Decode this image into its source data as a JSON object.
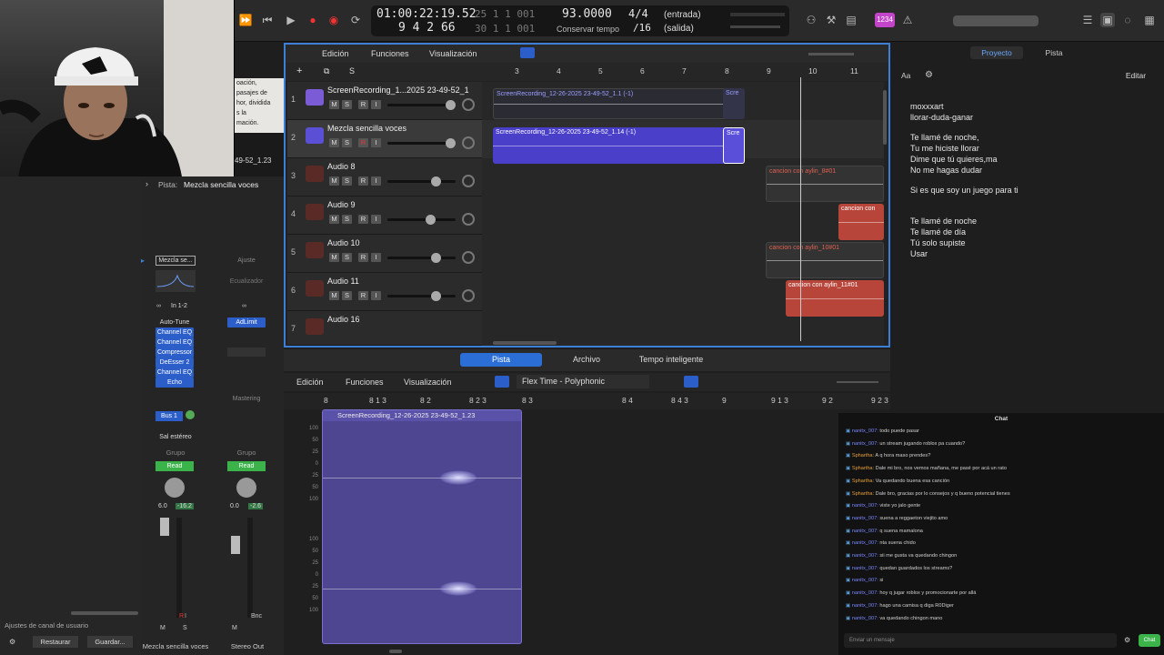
{
  "transport": {
    "time": "01:00:22:19.52",
    "bars_top": "25  1  1   001",
    "bars": "9  4  2   66",
    "bars_bottom": "30  1  1   001",
    "tempo": "93.0000",
    "tempo_label": "Conservar tempo",
    "signature": "4/4",
    "division": "/16",
    "in_label": "(entrada)",
    "out_label": "(salida)",
    "badge": "1234"
  },
  "webcam": {
    "overlay_time": "49-52_1.23",
    "note_lines": [
      "oación,",
      "pasajes de",
      "hor, dividida",
      "s la",
      "mación."
    ]
  },
  "inspector": {
    "track_label": "Pista:",
    "track_name": "Mezcla sencilla voces",
    "strip1_name": "Mezcla se...",
    "strip2_setting": "Ajuste",
    "eq_label": "Ecualizador",
    "input": "In 1-2",
    "plugins": [
      "Auto-Tune",
      "Channel EQ",
      "Channel EQ",
      "Compressor",
      "DeEsser 2",
      "Channel EQ",
      "Echo"
    ],
    "strip2_plugin": "AdLimit",
    "mastering": "Mastering",
    "bus": "Bus 1",
    "output": "Sal estéreo",
    "group": "Grupo",
    "read": "Read",
    "vol1": "6.0",
    "peak1": "-16.2",
    "vol2": "0.0",
    "peak2": "-2.6",
    "bnc": "Bnc",
    "m": "M",
    "s": "S",
    "r": "R",
    "i": "I",
    "strip1_footer": "Mezcla sencilla voces",
    "strip2_footer": "Stereo Out",
    "channel_settings": "Ajustes de canal de usuario",
    "restore": "Restaurar",
    "save": "Guardar..."
  },
  "arrange": {
    "menus": [
      "Edición",
      "Funciones",
      "Visualización"
    ],
    "ruler": [
      "3",
      "4",
      "5",
      "6",
      "7",
      "8",
      "9",
      "10",
      "11"
    ],
    "tracks": [
      {
        "num": "1",
        "name": "ScreenRecording_1...2025 23-49-52_1",
        "color": "#7b5bd6"
      },
      {
        "num": "2",
        "name": "Mezcla sencilla voces",
        "color": "#5b4fd6"
      },
      {
        "num": "3",
        "name": "Audio 8",
        "color": "#b8453a"
      },
      {
        "num": "4",
        "name": "Audio 9",
        "color": "#b8453a"
      },
      {
        "num": "5",
        "name": "Audio 10",
        "color": "#b8453a"
      },
      {
        "num": "6",
        "name": "Audio 11",
        "color": "#b8453a"
      },
      {
        "num": "7",
        "name": "Audio 16",
        "color": "#b8453a"
      }
    ],
    "regions": {
      "r1": "ScreenRecording_12-26-2025 23-49-52_1.1 (-1)",
      "r1b": "Scre",
      "r2": "ScreenRecording_12-26-2025 23-49-52_1.14 (-1)",
      "r2b": "Scre",
      "r3": "cancion con aylin_8#01",
      "r4": "cancion con",
      "r5": "cancion con aylin_10#01",
      "r6": "cancion con aylin_11#01"
    }
  },
  "editor": {
    "tabs": [
      "Pista",
      "Archivo",
      "Tempo inteligente"
    ],
    "menus": [
      "Edición",
      "Funciones",
      "Visualización"
    ],
    "flex": "Flex Time - Polyphonic",
    "ruler": [
      "8",
      "8 1 3",
      "8 2",
      "8 2 3",
      "8 3",
      "8 4",
      "8 4 3",
      "9",
      "9 1 3",
      "9 2",
      "9 2 3"
    ],
    "region_name": "ScreenRecording_12-26-2025 23-49-52_1.23",
    "db_scale": [
      "100",
      "50",
      "25",
      "0",
      "25",
      "50",
      "100",
      "100",
      "50",
      "25",
      "0",
      "25",
      "50",
      "100"
    ]
  },
  "right": {
    "tabs": [
      "Proyecto",
      "Pista"
    ],
    "edit": "Editar",
    "aa": "Aa",
    "lyrics": [
      "moxxxart",
      "llorar-duda-ganar",
      "",
      "Te llamé de noche,",
      "Tu me hiciste llorar",
      "Dime que tú quieres,ma",
      "No me hagas dudar",
      "",
      "Si es que soy un juego para ti",
      "",
      "",
      "Te llamé de noche",
      "Te llamé de día",
      "Tú solo supiste",
      "Usar"
    ]
  },
  "chat": {
    "title": "Chat",
    "messages": [
      {
        "user": "nanitx_007:",
        "text": "todo puede pasar",
        "c": "u1"
      },
      {
        "user": "nanitx_007:",
        "text": "un stream jugando roblox pa cuando?",
        "c": "u1"
      },
      {
        "user": "Sphartha:",
        "text": "A q hora maso prendes?",
        "c": "u2"
      },
      {
        "user": "Sphartha:",
        "text": "Dale mi bro, nos vemos mañana, me pasé por acá un rato",
        "c": "u2"
      },
      {
        "user": "Sphartha:",
        "text": "Va quedando buena esa canción",
        "c": "u2"
      },
      {
        "user": "Sphartha:",
        "text": "Dale bro, gracias por lo consejos y q bueno potencial tienes",
        "c": "u2"
      },
      {
        "user": "nanitx_007:",
        "text": "viste yo jalo gente",
        "c": "u1"
      },
      {
        "user": "nanitx_007:",
        "text": "suena a reggaeton viejito amo",
        "c": "u1"
      },
      {
        "user": "nanitx_007:",
        "text": "q suena mamalona",
        "c": "u1"
      },
      {
        "user": "nanitx_007:",
        "text": "nta suena chido",
        "c": "u1"
      },
      {
        "user": "nanitx_007:",
        "text": "sii me gusta va quedando chingon",
        "c": "u1"
      },
      {
        "user": "nanitx_007:",
        "text": "quedan guardados los streams?",
        "c": "u1"
      },
      {
        "user": "nanitx_007:",
        "text": "si",
        "c": "u1"
      },
      {
        "user": "nanitx_007:",
        "text": "hoy q jugar roblox y promocionarte por allá",
        "c": "u1"
      },
      {
        "user": "nanitx_007:",
        "text": "hago una camisa q diga R0Diger",
        "c": "u1"
      },
      {
        "user": "nanitx_007:",
        "text": "va quedando chingon mano",
        "c": "u1"
      }
    ],
    "placeholder": "Enviar un mensaje",
    "send": "Chat"
  }
}
